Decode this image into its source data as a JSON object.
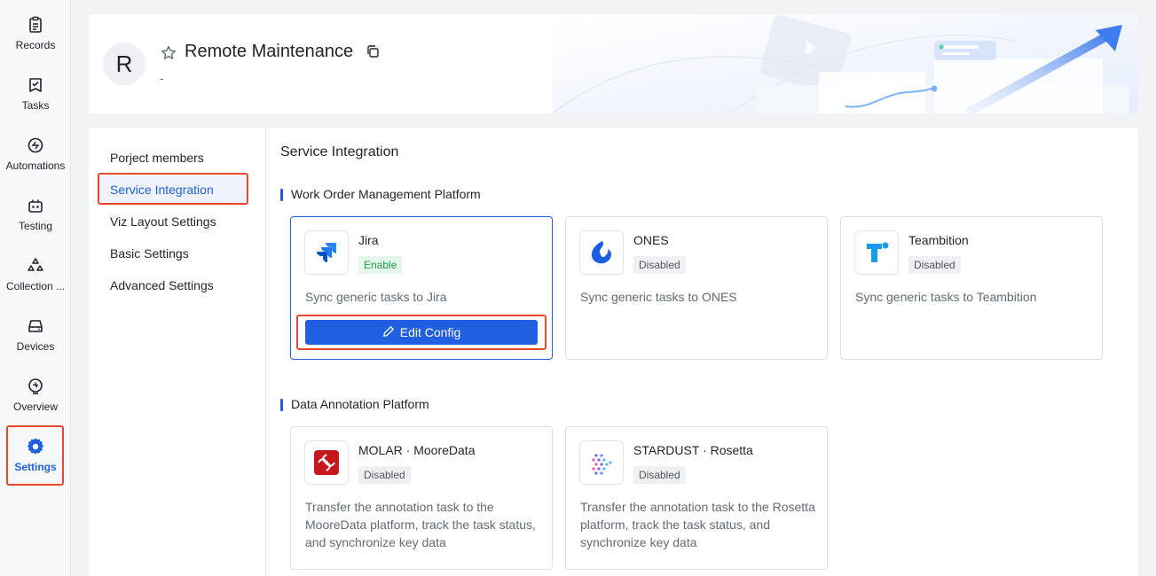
{
  "rail": {
    "items": [
      {
        "label": "Records",
        "icon": "clipboard-icon"
      },
      {
        "label": "Tasks",
        "icon": "task-check-icon"
      },
      {
        "label": "Automations",
        "icon": "automation-icon"
      },
      {
        "label": "Testing",
        "icon": "testing-icon"
      },
      {
        "label": "Collection ...",
        "icon": "collection-icon"
      },
      {
        "label": "Devices",
        "icon": "device-icon"
      },
      {
        "label": "Overview",
        "icon": "overview-icon"
      },
      {
        "label": "Settings",
        "icon": "gear-icon"
      }
    ],
    "active": "Settings"
  },
  "project": {
    "avatar_letter": "R",
    "title": "Remote Maintenance",
    "subtitle": "-"
  },
  "settings_nav": {
    "items": [
      "Porject members",
      "Service Integration",
      "Viz Layout Settings",
      "Basic Settings",
      "Advanced Settings"
    ],
    "active": "Service Integration"
  },
  "content": {
    "title": "Service Integration",
    "sections": [
      {
        "title": "Work Order Management Platform",
        "cards": [
          {
            "name": "Jira",
            "status": "Enable",
            "desc": "Sync generic tasks to Jira",
            "button": "Edit Config",
            "logo": "jira-logo"
          },
          {
            "name": "ONES",
            "status": "Disabled",
            "desc": "Sync generic tasks to ONES",
            "logo": "ones-logo"
          },
          {
            "name": "Teambition",
            "status": "Disabled",
            "desc": "Sync generic tasks to Teambition",
            "logo": "teambition-logo"
          }
        ]
      },
      {
        "title": "Data Annotation Platform",
        "cards": [
          {
            "name": "MOLAR · MooreData",
            "status": "Disabled",
            "desc": "Transfer the annotation task to the MooreData platform, track the task status, and synchronize key data",
            "logo": "mooredata-logo"
          },
          {
            "name": "STARDUST · Rosetta",
            "status": "Disabled",
            "desc": "Transfer the annotation task to the Rosetta platform, track the task status, and synchronize key data",
            "logo": "rosetta-logo"
          }
        ]
      }
    ]
  },
  "colors": {
    "accent": "#1f5fe0",
    "highlight": "#e8492c",
    "enable_bg": "#e4f7ea",
    "enable_fg": "#1e9b4f"
  }
}
